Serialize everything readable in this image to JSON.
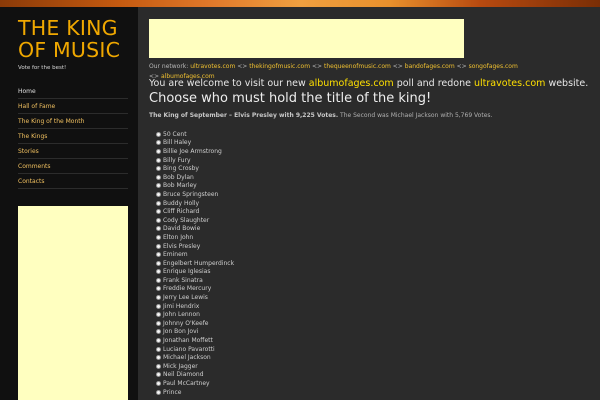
{
  "site": {
    "title": "THE KING OF MUSIC",
    "tagline": "Vote for the best!"
  },
  "nav": [
    {
      "label": "Home"
    },
    {
      "label": "Hall of Fame"
    },
    {
      "label": "The King of the Month"
    },
    {
      "label": "The Kings"
    },
    {
      "label": "Stories"
    },
    {
      "label": "Comments"
    },
    {
      "label": "Contacts"
    }
  ],
  "network": {
    "prefix": "Our network:",
    "separator": "<>",
    "links": [
      "ultravotes.com",
      "thekingofmusic.com",
      "thequeenofmusic.com",
      "bandofages.com",
      "songofages.com",
      "albumofages.com"
    ]
  },
  "welcome": {
    "before": "You are welcome to visit our new",
    "link1": "albumofages.com",
    "middle": "poll and redone",
    "link2": "ultravotes.com",
    "after": "website."
  },
  "headline": "Choose who must hold the title of the king!",
  "king_of_month": {
    "bold": "The King of September – Elvis Presley with 9,225 Votes.",
    "rest": "The Second was Michael Jackson with 5,769 Votes."
  },
  "poll": {
    "options": [
      "50 Cent",
      "Bill Haley",
      "Billie Joe Armstrong",
      "Billy Fury",
      "Bing Crosby",
      "Bob Dylan",
      "Bob Marley",
      "Bruce Springsteen",
      "Buddy Holly",
      "Cliff Richard",
      "Cody Slaughter",
      "David Bowie",
      "Elton John",
      "Elvis Presley",
      "Eminem",
      "Engelbert Humperdinck",
      "Enrique Iglesias",
      "Frank Sinatra",
      "Freddie Mercury",
      "Jerry Lee Lewis",
      "Jimi Hendrix",
      "John Lennon",
      "Johnny O'Keefe",
      "Jon Bon Jovi",
      "Jonathan Moffett",
      "Luciano Pavarotti",
      "Michael Jackson",
      "Mick Jagger",
      "Neil Diamond",
      "Paul McCartney",
      "Prince"
    ]
  },
  "colors": {
    "accent": "#f0a800",
    "link": "#f0c030",
    "highlight": "#ffe000",
    "ad_background": "#ffffc0",
    "sidebar": "#101010",
    "page": "#2b2b2b"
  }
}
